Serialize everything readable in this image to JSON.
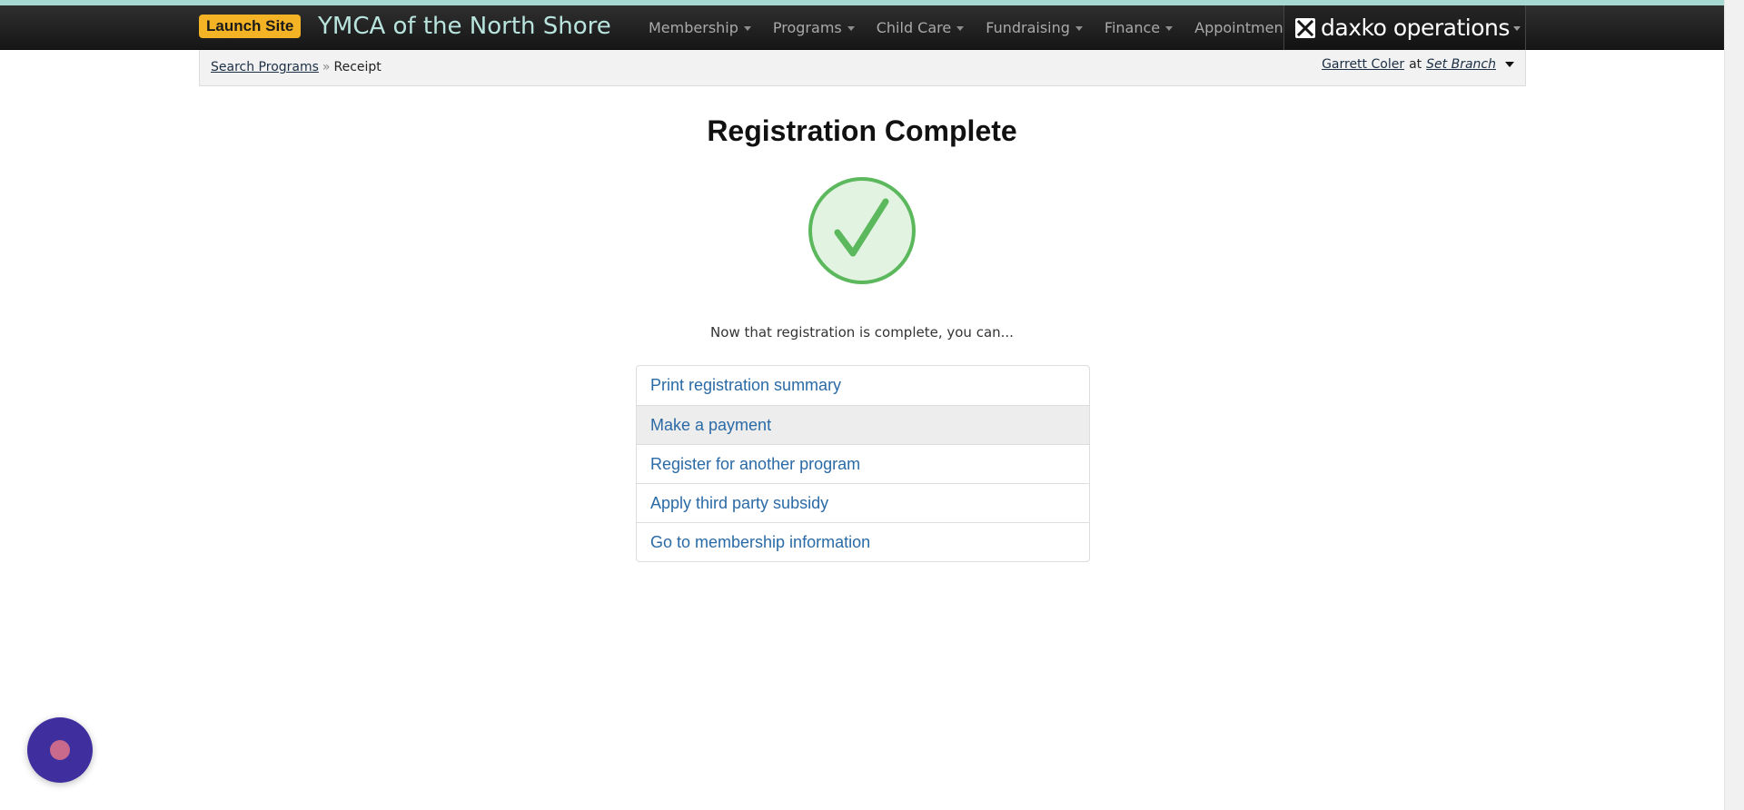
{
  "header": {
    "launch_label": "Launch Site",
    "org_title": "YMCA of the North Shore",
    "nav": [
      {
        "label": "Membership"
      },
      {
        "label": "Programs"
      },
      {
        "label": "Child Care"
      },
      {
        "label": "Fundraising"
      },
      {
        "label": "Finance"
      },
      {
        "label": "Appointments"
      }
    ],
    "brand": "daxko operations"
  },
  "breadcrumb": {
    "link": "Search Programs",
    "separator": "»",
    "current": "Receipt"
  },
  "user": {
    "name": "Garrett Coler",
    "at": "at",
    "branch": "Set Branch"
  },
  "main": {
    "title": "Registration Complete",
    "intro": "Now that registration is complete, you can...",
    "actions": [
      {
        "label": "Print registration summary"
      },
      {
        "label": "Make a payment"
      },
      {
        "label": "Register for another program"
      },
      {
        "label": "Apply third party subsidy"
      },
      {
        "label": "Go to membership information"
      }
    ]
  },
  "colors": {
    "accent_strip": "#a7d8d1",
    "launch_badge": "#f4b324",
    "success_green": "#5cb85c",
    "link_blue": "#2a6aa6",
    "chat_button": "#3f2f9e"
  }
}
